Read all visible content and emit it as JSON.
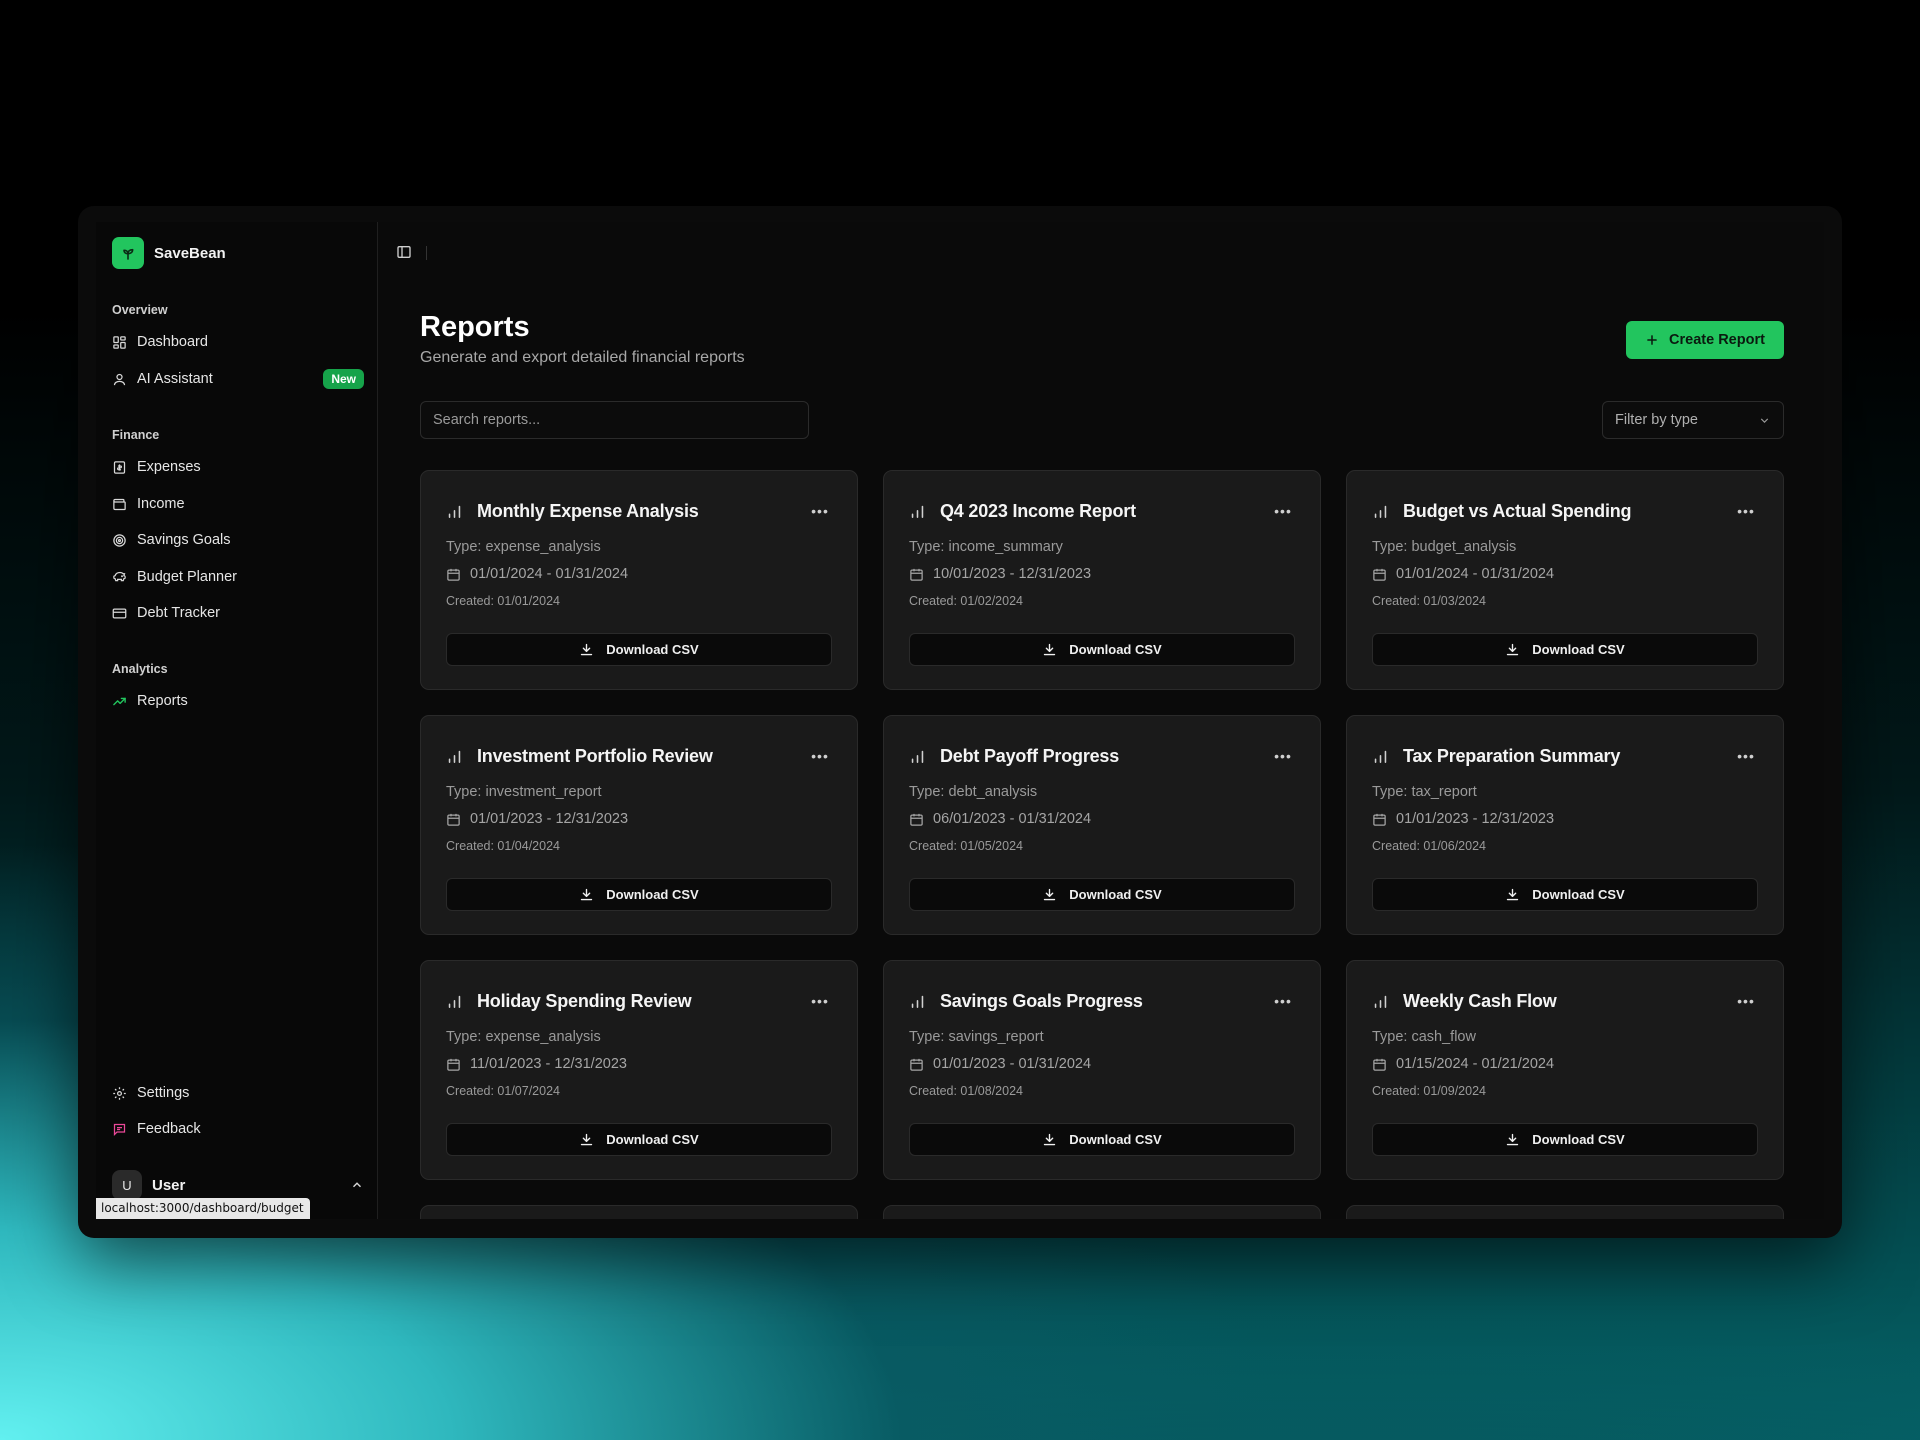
{
  "app": {
    "name": "SaveBean"
  },
  "sidebar": {
    "groups": [
      {
        "label": "Overview",
        "items": [
          {
            "label": "Dashboard",
            "icon": "dashboard-icon"
          },
          {
            "label": "AI Assistant",
            "icon": "user-icon",
            "badge": "New"
          }
        ]
      },
      {
        "label": "Finance",
        "items": [
          {
            "label": "Expenses",
            "icon": "receipt-icon"
          },
          {
            "label": "Income",
            "icon": "wallet-icon"
          },
          {
            "label": "Savings Goals",
            "icon": "target-icon"
          },
          {
            "label": "Budget Planner",
            "icon": "piggy-bank-icon"
          },
          {
            "label": "Debt Tracker",
            "icon": "credit-card-icon"
          }
        ]
      },
      {
        "label": "Analytics",
        "items": [
          {
            "label": "Reports",
            "icon": "trending-up-icon",
            "active": true
          }
        ]
      }
    ],
    "footer": [
      {
        "label": "Settings",
        "icon": "gear-icon"
      },
      {
        "label": "Feedback",
        "icon": "message-icon"
      }
    ],
    "user": {
      "initial": "U",
      "name": "User"
    }
  },
  "status_bar": {
    "url": "localhost:3000/dashboard/budget"
  },
  "main": {
    "title": "Reports",
    "subtitle": "Generate and export detailed financial reports",
    "create_button": "Create Report",
    "search_placeholder": "Search reports...",
    "filter_label": "Filter by type"
  },
  "reports": [
    {
      "title": "Monthly Expense Analysis",
      "type": "Type: expense_analysis",
      "range": "01/01/2024 - 01/31/2024",
      "created": "Created: 01/01/2024",
      "action": "Download CSV"
    },
    {
      "title": "Q4 2023 Income Report",
      "type": "Type: income_summary",
      "range": "10/01/2023 - 12/31/2023",
      "created": "Created: 01/02/2024",
      "action": "Download CSV"
    },
    {
      "title": "Budget vs Actual Spending",
      "type": "Type: budget_analysis",
      "range": "01/01/2024 - 01/31/2024",
      "created": "Created: 01/03/2024",
      "action": "Download CSV"
    },
    {
      "title": "Investment Portfolio Review",
      "type": "Type: investment_report",
      "range": "01/01/2023 - 12/31/2023",
      "created": "Created: 01/04/2024",
      "action": "Download CSV"
    },
    {
      "title": "Debt Payoff Progress",
      "type": "Type: debt_analysis",
      "range": "06/01/2023 - 01/31/2024",
      "created": "Created: 01/05/2024",
      "action": "Download CSV"
    },
    {
      "title": "Tax Preparation Summary",
      "type": "Type: tax_report",
      "range": "01/01/2023 - 12/31/2023",
      "created": "Created: 01/06/2024",
      "action": "Download CSV"
    },
    {
      "title": "Holiday Spending Review",
      "type": "Type: expense_analysis",
      "range": "11/01/2023 - 12/31/2023",
      "created": "Created: 01/07/2024",
      "action": "Download CSV"
    },
    {
      "title": "Savings Goals Progress",
      "type": "Type: savings_report",
      "range": "01/01/2023 - 01/31/2024",
      "created": "Created: 01/08/2024",
      "action": "Download CSV"
    },
    {
      "title": "Weekly Cash Flow",
      "type": "Type: cash_flow",
      "range": "01/15/2024 - 01/21/2024",
      "created": "Created: 01/09/2024",
      "action": "Download CSV"
    }
  ],
  "colors": {
    "accent": "#22c55e",
    "accent_dark": "#16a34a",
    "card_bg": "#1a1a1a",
    "feedback_icon": "#ec4899"
  }
}
